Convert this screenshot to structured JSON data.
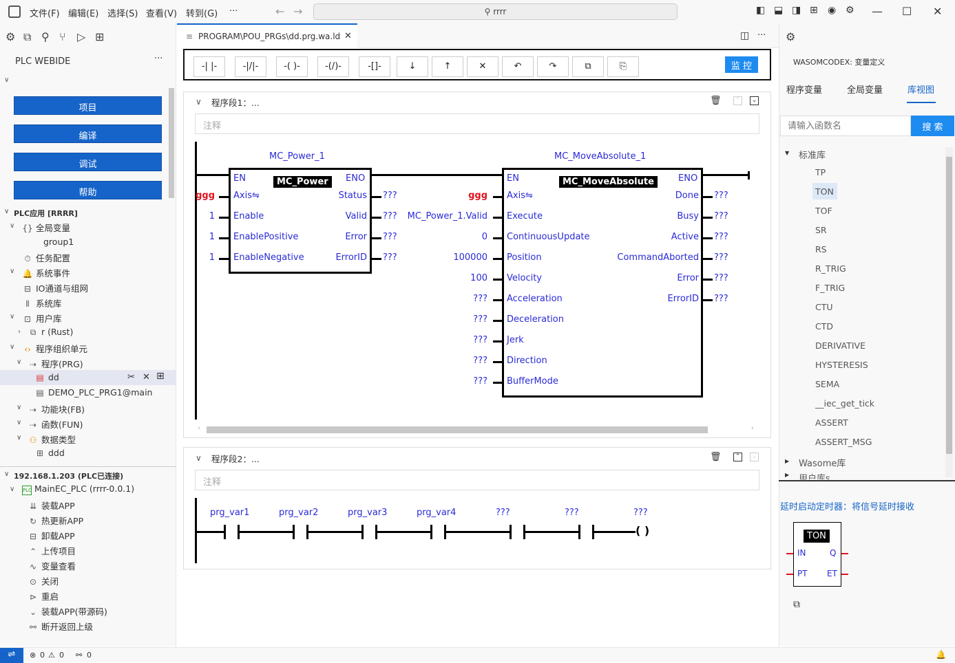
{
  "menu": {
    "file": "文件(F)",
    "edit": "编辑(E)",
    "select": "选择(S)",
    "view": "查看(V)",
    "goto": "转到(G)",
    "more": "···",
    "search": "rrrr"
  },
  "sidebar": {
    "title": "PLC WEBIDE",
    "more": "···",
    "buttons": [
      "项目",
      "编译",
      "调试",
      "帮助"
    ],
    "section1": "PLC应用 [RRRR]",
    "tree": [
      "全局变量",
      "group1",
      "任务配置",
      "系统事件",
      "IO通道与组网",
      "系统库",
      "用户库",
      "r (Rust)",
      "程序组织单元",
      "程序(PRG)",
      "dd",
      "DEMO_PLC_PRG1@main",
      "功能块(FB)",
      "函数(FUN)",
      "数据类型",
      "ddd"
    ],
    "section2": "192.168.1.203 (PLC已连接)",
    "tree2": [
      "MainEC_PLC (rrrr-0.0.1)",
      "装载APP",
      "热更新APP",
      "卸载APP",
      "上传项目",
      "变量查看",
      "关闭",
      "重启",
      "装载APP(带源码)",
      "断开返回上级"
    ]
  },
  "editor": {
    "tab": "PROGRAM\\POU_PRGs\\dd.prg.wa.ld",
    "toolbar": [
      "-| |-",
      "-|/|-",
      "-( )-",
      "-(/)-",
      "-[]-",
      "↓",
      "↑",
      "✕",
      "↶",
      "↷",
      "⧉",
      "⎘"
    ],
    "monitor": "监 控",
    "seg1": "程序段1：...",
    "seg2": "程序段2：...",
    "comment": "注释",
    "b1": {
      "instance": "MC_Power_1",
      "type": "MC_Power",
      "en": "EN",
      "eno": "ENO",
      "inputs": [
        "Axis⇋",
        "Enable",
        "EnablePositive",
        "EnableNegative"
      ],
      "invals": [
        "ggg",
        "1",
        "1",
        "1"
      ],
      "outputs": [
        "Status",
        "Valid",
        "Error",
        "ErrorID"
      ],
      "outvals": [
        "???",
        "???",
        "???",
        "???"
      ]
    },
    "b2": {
      "instance": "MC_MoveAbsolute_1",
      "type": "MC_MoveAbsolute",
      "en": "EN",
      "eno": "ENO",
      "inputs": [
        "Axis⇋",
        "Execute",
        "ContinuousUpdate",
        "Position",
        "Velocity",
        "Acceleration",
        "Deceleration",
        "Jerk",
        "Direction",
        "BufferMode"
      ],
      "invals": [
        "ggg",
        "MC_Power_1.Valid",
        "0",
        "100000",
        "100",
        "???",
        "???",
        "???",
        "???",
        "???"
      ],
      "outputs": [
        "Done",
        "Busy",
        "Active",
        "CommandAborted",
        "Error",
        "ErrorID"
      ],
      "outvals": [
        "???",
        "???",
        "???",
        "???",
        "???",
        "???"
      ]
    },
    "contacts": [
      "prg_var1",
      "prg_var2",
      "prg_var3",
      "prg_var4",
      "???",
      "???",
      "???"
    ]
  },
  "right": {
    "title": "WASOMCODEX: 变量定义",
    "tabs": [
      "程序变量",
      "全局变量",
      "库视图"
    ],
    "placeholder": "请输入函数名",
    "search": "搜 索",
    "stdlib": "标准库",
    "items": [
      "TP",
      "TON",
      "TOF",
      "SR",
      "RS",
      "R_TRIG",
      "F_TRIG",
      "CTU",
      "CTD",
      "DERIVATIVE",
      "HYSTERESIS",
      "SEMA",
      "__iec_get_tick",
      "ASSERT",
      "ASSERT_MSG"
    ],
    "wasome": "Wasome库",
    "userlib": "用户库s",
    "desc": "延时启动定时器：将信号延时接收",
    "ton": {
      "name": "TON",
      "in": "IN",
      "q": "Q",
      "pt": "PT",
      "et": "ET"
    }
  },
  "status": {
    "errors": "0",
    "warnings": "0",
    "ports": "0"
  },
  "colors": {
    "accent": "#1664c9",
    "monitor": "#1e8bf0",
    "label": "#2a2ad6",
    "var": "#e0141e"
  }
}
